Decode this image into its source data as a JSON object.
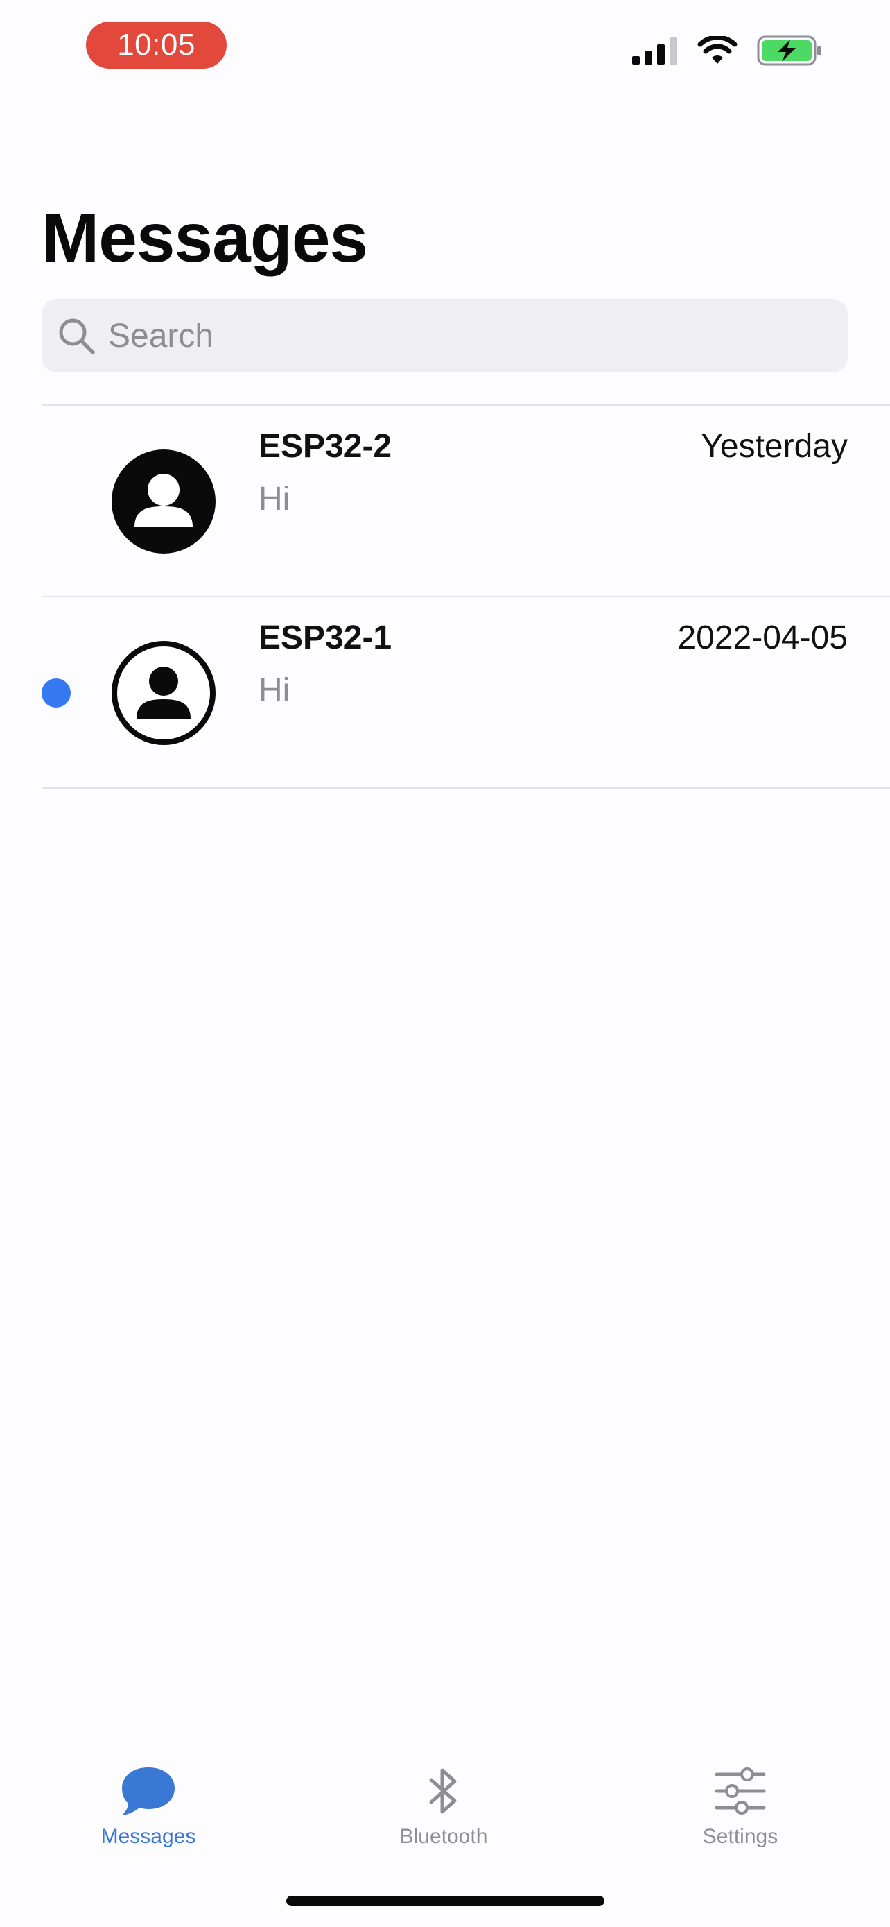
{
  "status_bar": {
    "time": "10:05",
    "icons": [
      "cellular-signal-icon",
      "wifi-icon",
      "battery-charging-icon"
    ]
  },
  "header": {
    "title": "Messages"
  },
  "search": {
    "placeholder": "Search",
    "value": "",
    "icon": "search-icon"
  },
  "conversations": [
    {
      "name": "ESP32-2",
      "time": "Yesterday",
      "preview": "Hi",
      "unread": false,
      "avatar": "person-filled-icon"
    },
    {
      "name": "ESP32-1",
      "time": "2022-04-05",
      "preview": "Hi",
      "unread": true,
      "avatar": "person-outline-icon"
    }
  ],
  "tab_bar": {
    "active": "Messages",
    "tabs": [
      {
        "label": "Messages",
        "icon": "speech-bubble-icon"
      },
      {
        "label": "Bluetooth",
        "icon": "bluetooth-icon"
      },
      {
        "label": "Settings",
        "icon": "sliders-icon"
      }
    ]
  },
  "colors": {
    "accent": "#3a78d6",
    "unread_dot": "#3479f1",
    "time_pill": "#e2483c",
    "battery_fill": "#4cd964",
    "secondary_text": "#8e8d93",
    "search_background": "#efeef2"
  }
}
